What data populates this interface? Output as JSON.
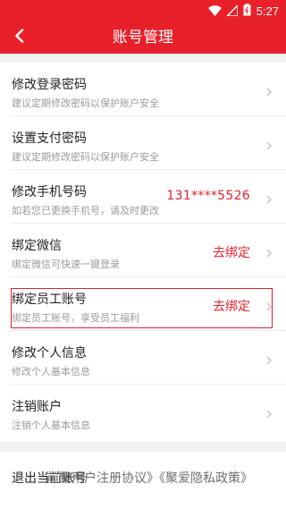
{
  "status_bar": {
    "time": "5:27",
    "icons": [
      "wifi-icon",
      "signal-icon",
      "battery-icon"
    ]
  },
  "app_bar": {
    "title": "账号管理",
    "back_icon": "chevron-left-icon"
  },
  "menu": {
    "items": [
      {
        "title": "修改登录密码",
        "subtitle": "建议定期修改密码以保护账户安全",
        "value": ""
      },
      {
        "title": "设置支付密码",
        "subtitle": "建议定期修改密码以保护账户安全",
        "value": ""
      },
      {
        "title": "修改手机号码",
        "subtitle": "如若您已更换手机号，请及时更改",
        "value": "131****5526"
      },
      {
        "title": "绑定微信",
        "subtitle": "绑定微信可快速一键登录",
        "value": "去绑定"
      },
      {
        "title": "绑定员工账号",
        "subtitle": "绑定员工账号，享受员工福利",
        "value": "去绑定"
      },
      {
        "title": "修改个人信息",
        "subtitle": "修改个人基本信息",
        "value": ""
      },
      {
        "title": "注销账户",
        "subtitle": "注销个人基本信息",
        "value": ""
      }
    ]
  },
  "footer": {
    "logout_label": "退出当前账号",
    "overlay_text": "前聚用户注册协议》《聚爱隐私政策》"
  },
  "colors": {
    "brand_red": "#e8202a",
    "background": "#f2f2f2",
    "title_text": "#222222",
    "subtitle_text": "#9a9a9a"
  }
}
